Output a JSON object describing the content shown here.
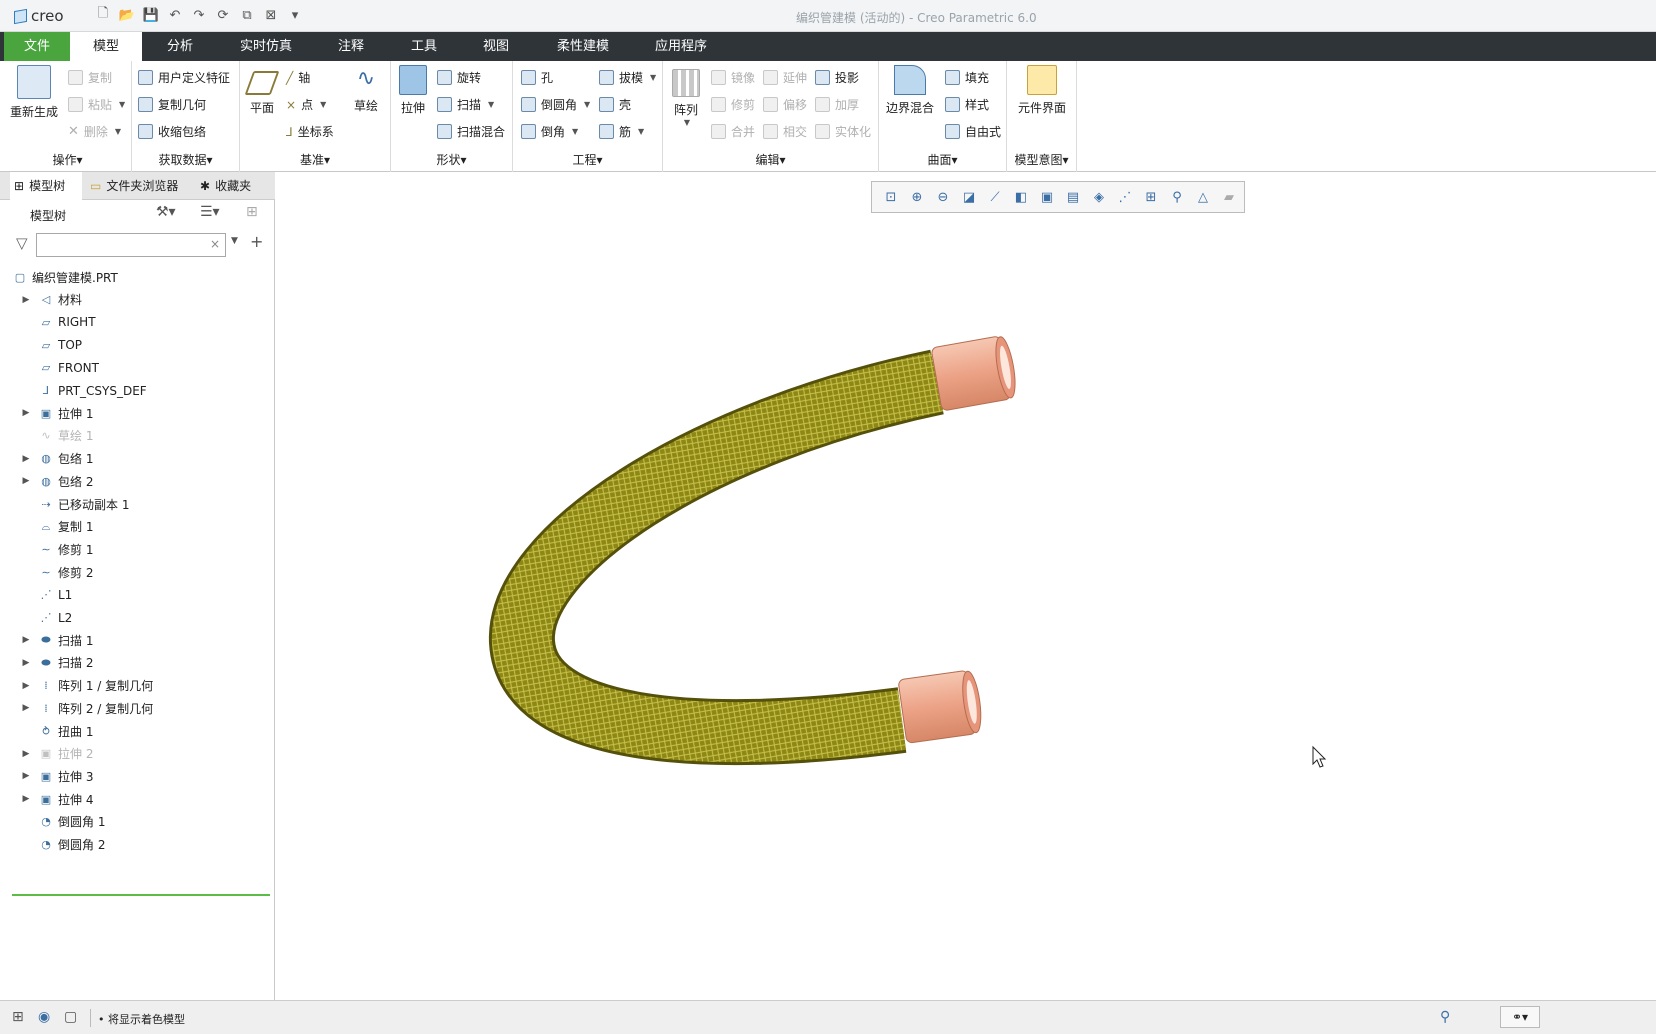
{
  "app": {
    "logo": "creo",
    "window_title": "编织管建模 (活动的) - Creo Parametric 6.0"
  },
  "tabs": [
    "文件",
    "模型",
    "分析",
    "实时仿真",
    "注释",
    "工具",
    "视图",
    "柔性建模",
    "应用程序"
  ],
  "ribbon": {
    "operations": {
      "label": "操作",
      "regen": "重新生成",
      "copy": "复制",
      "paste": "粘贴",
      "delete": "删除"
    },
    "get_data": {
      "label": "获取数据",
      "udf": "用户定义特征",
      "copy_geom": "复制几何",
      "shrinkwrap": "收缩包络"
    },
    "datum": {
      "label": "基准",
      "plane": "平面",
      "axis": "轴",
      "point": "点",
      "csys": "坐标系",
      "sketch": "草绘"
    },
    "shapes": {
      "label": "形状",
      "extrude": "拉伸",
      "revolve": "旋转",
      "sweep": "扫描",
      "swept_blend": "扫描混合"
    },
    "engineering": {
      "label": "工程",
      "hole": "孔",
      "round": "倒圆角",
      "chamfer": "倒角",
      "draft": "拔模",
      "shell": "壳",
      "rib": "筋"
    },
    "editing": {
      "label": "编辑",
      "pattern": "阵列",
      "mirror": "镜像",
      "trim": "修剪",
      "merge": "合并",
      "extend": "延伸",
      "offset": "偏移",
      "intersect": "相交",
      "project": "投影",
      "thicken": "加厚",
      "solidify": "实体化"
    },
    "surfaces": {
      "label": "曲面",
      "boundary_blend": "边界混合",
      "fill": "填充",
      "style": "样式",
      "freestyle": "自由式"
    },
    "model_intent": {
      "label": "模型意图",
      "component_interface": "元件界面"
    }
  },
  "panel": {
    "tabs": [
      "模型树",
      "文件夹浏览器",
      "收藏夹"
    ],
    "title": "模型树",
    "filter_placeholder": ""
  },
  "tree": [
    {
      "label": "编织管建模.PRT",
      "icon": "part-icon",
      "expand": false,
      "root": true,
      "sup": false
    },
    {
      "label": "材料",
      "icon": "material-icon",
      "expand": true,
      "sup": false
    },
    {
      "label": "RIGHT",
      "icon": "datum-plane-icon",
      "expand": false,
      "sup": false
    },
    {
      "label": "TOP",
      "icon": "datum-plane-icon",
      "expand": false,
      "sup": false
    },
    {
      "label": "FRONT",
      "icon": "datum-plane-icon",
      "expand": false,
      "sup": false
    },
    {
      "label": "PRT_CSYS_DEF",
      "icon": "csys-icon",
      "expand": false,
      "sup": false
    },
    {
      "label": "拉伸 1",
      "icon": "extrude-icon",
      "expand": true,
      "sup": false
    },
    {
      "label": "草绘 1",
      "icon": "sketch-icon",
      "expand": false,
      "sup": true
    },
    {
      "label": "包络 1",
      "icon": "wrap-icon",
      "expand": true,
      "sup": false
    },
    {
      "label": "包络 2",
      "icon": "wrap-icon",
      "expand": true,
      "sup": false
    },
    {
      "label": "已移动副本 1",
      "icon": "moved-copy-icon",
      "expand": false,
      "sup": false
    },
    {
      "label": "复制 1",
      "icon": "copy-icon",
      "expand": false,
      "sup": false
    },
    {
      "label": "修剪 1",
      "icon": "trim-icon",
      "expand": false,
      "sup": false
    },
    {
      "label": "修剪 2",
      "icon": "trim-icon",
      "expand": false,
      "sup": false
    },
    {
      "label": "L1",
      "icon": "layer-icon",
      "expand": false,
      "sup": false
    },
    {
      "label": "L2",
      "icon": "layer-icon",
      "expand": false,
      "sup": false
    },
    {
      "label": "扫描 1",
      "icon": "sweep-icon",
      "expand": true,
      "sup": false
    },
    {
      "label": "扫描 2",
      "icon": "sweep-icon",
      "expand": true,
      "sup": false
    },
    {
      "label": "阵列 1 / 复制几何",
      "icon": "pattern-icon",
      "expand": true,
      "sup": false
    },
    {
      "label": "阵列 2 / 复制几何",
      "icon": "pattern-icon",
      "expand": true,
      "sup": false
    },
    {
      "label": "扭曲 1",
      "icon": "warp-icon",
      "expand": false,
      "sup": false
    },
    {
      "label": "拉伸 2",
      "icon": "extrude-icon",
      "expand": true,
      "sup": true
    },
    {
      "label": "拉伸 3",
      "icon": "extrude-icon",
      "expand": true,
      "sup": false
    },
    {
      "label": "拉伸 4",
      "icon": "extrude-icon",
      "expand": true,
      "sup": false
    },
    {
      "label": "倒圆角 1",
      "icon": "round-icon",
      "expand": false,
      "sup": false
    },
    {
      "label": "倒圆角 2",
      "icon": "round-icon",
      "expand": false,
      "sup": false
    }
  ],
  "status": {
    "message": "将显示着色模型"
  },
  "colors": {
    "hose": "#8f8a18",
    "fitting": "#e9a486",
    "tabbar": "#2f3439",
    "file_tab": "#4aa53f"
  }
}
